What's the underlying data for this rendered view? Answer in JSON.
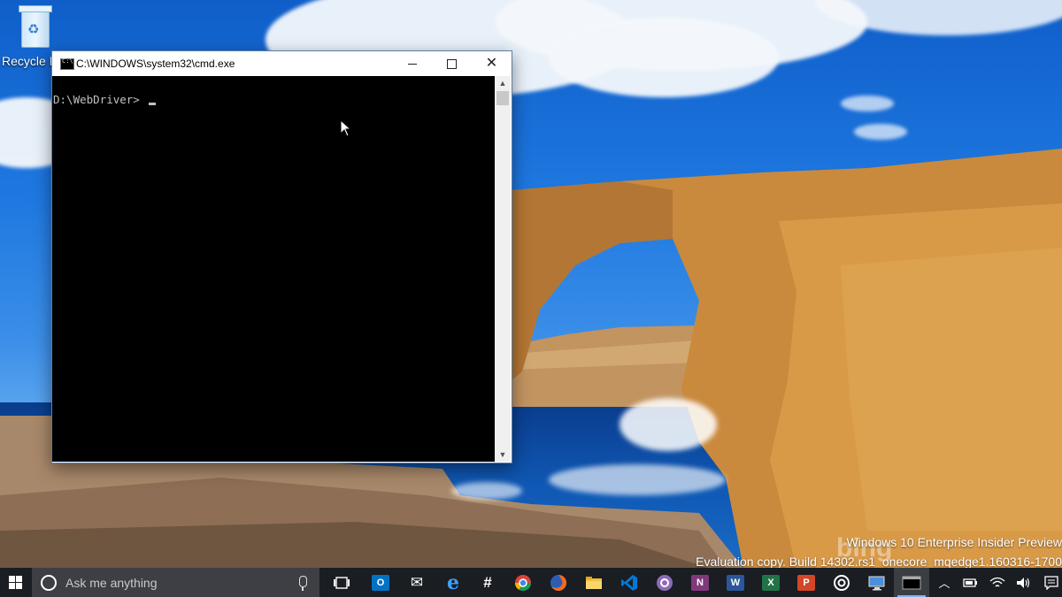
{
  "desktop": {
    "recycle_bin_label": "Recycle Bin"
  },
  "cmd_window": {
    "title": "C:\\WINDOWS\\system32\\cmd.exe",
    "prompt": "D:\\WebDriver>",
    "scroll_up": "▲",
    "scroll_down": "▼"
  },
  "watermark": {
    "line1": "Windows 10 Enterprise Insider Preview",
    "line2": "Evaluation copy. Build 14302.rs1_onecore_mqedge1.160316-1700",
    "bing": "bing"
  },
  "taskbar": {
    "search_placeholder": "Ask me anything",
    "apps": [
      {
        "name": "task-view",
        "label": "",
        "color": "#1a1d22"
      },
      {
        "name": "outlook",
        "label": "O",
        "color": "#0072c6"
      },
      {
        "name": "mail",
        "label": "✉",
        "color": "#1a1d22"
      },
      {
        "name": "edge",
        "label": "e",
        "color": "#1a7dd6"
      },
      {
        "name": "slack",
        "label": "#",
        "color": "#1a1d22"
      },
      {
        "name": "chrome",
        "label": "",
        "color": "#dd4b39"
      },
      {
        "name": "firefox",
        "label": "",
        "color": "#e66000"
      },
      {
        "name": "file-explorer",
        "label": "",
        "color": "#f0c040"
      },
      {
        "name": "visual-studio-code",
        "label": "",
        "color": "#007acc"
      },
      {
        "name": "github",
        "label": "",
        "color": "#6e5494"
      },
      {
        "name": "onenote",
        "label": "N",
        "color": "#80397b"
      },
      {
        "name": "word",
        "label": "W",
        "color": "#2b579a"
      },
      {
        "name": "excel",
        "label": "X",
        "color": "#217346"
      },
      {
        "name": "powerpoint",
        "label": "P",
        "color": "#d24726"
      },
      {
        "name": "groove",
        "label": "",
        "color": "#1a1d22"
      },
      {
        "name": "remote-desktop",
        "label": "",
        "color": "#1a1d22"
      },
      {
        "name": "cmd",
        "label": "",
        "color": "#000000"
      }
    ]
  }
}
